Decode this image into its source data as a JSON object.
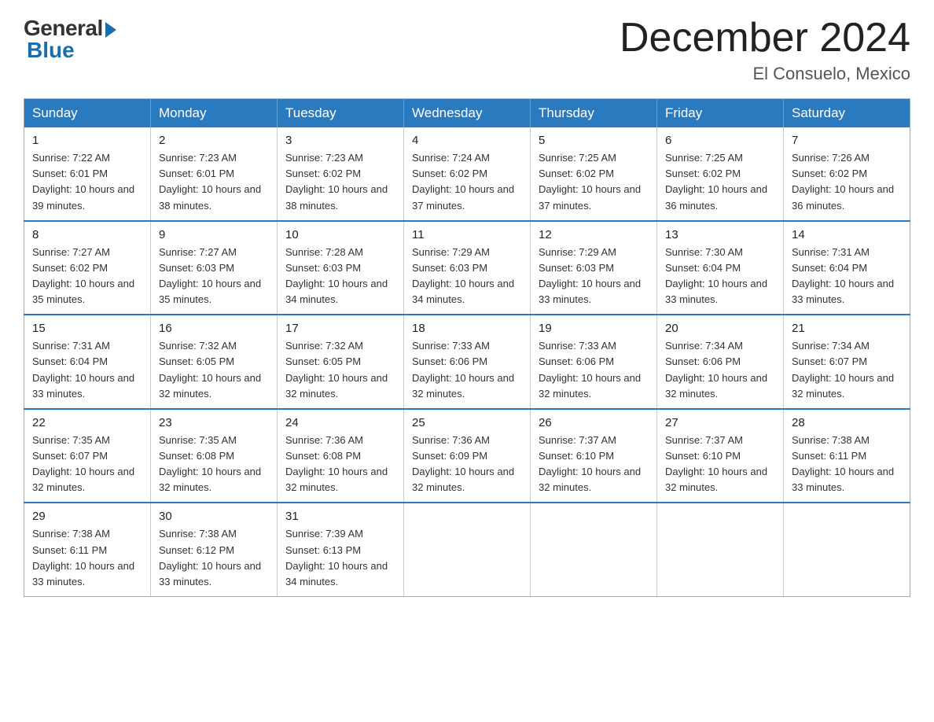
{
  "logo": {
    "general": "General",
    "blue": "Blue"
  },
  "title": "December 2024",
  "location": "El Consuelo, Mexico",
  "days_of_week": [
    "Sunday",
    "Monday",
    "Tuesday",
    "Wednesday",
    "Thursday",
    "Friday",
    "Saturday"
  ],
  "weeks": [
    [
      {
        "day": "1",
        "sunrise": "7:22 AM",
        "sunset": "6:01 PM",
        "daylight": "10 hours and 39 minutes."
      },
      {
        "day": "2",
        "sunrise": "7:23 AM",
        "sunset": "6:01 PM",
        "daylight": "10 hours and 38 minutes."
      },
      {
        "day": "3",
        "sunrise": "7:23 AM",
        "sunset": "6:02 PM",
        "daylight": "10 hours and 38 minutes."
      },
      {
        "day": "4",
        "sunrise": "7:24 AM",
        "sunset": "6:02 PM",
        "daylight": "10 hours and 37 minutes."
      },
      {
        "day": "5",
        "sunrise": "7:25 AM",
        "sunset": "6:02 PM",
        "daylight": "10 hours and 37 minutes."
      },
      {
        "day": "6",
        "sunrise": "7:25 AM",
        "sunset": "6:02 PM",
        "daylight": "10 hours and 36 minutes."
      },
      {
        "day": "7",
        "sunrise": "7:26 AM",
        "sunset": "6:02 PM",
        "daylight": "10 hours and 36 minutes."
      }
    ],
    [
      {
        "day": "8",
        "sunrise": "7:27 AM",
        "sunset": "6:02 PM",
        "daylight": "10 hours and 35 minutes."
      },
      {
        "day": "9",
        "sunrise": "7:27 AM",
        "sunset": "6:03 PM",
        "daylight": "10 hours and 35 minutes."
      },
      {
        "day": "10",
        "sunrise": "7:28 AM",
        "sunset": "6:03 PM",
        "daylight": "10 hours and 34 minutes."
      },
      {
        "day": "11",
        "sunrise": "7:29 AM",
        "sunset": "6:03 PM",
        "daylight": "10 hours and 34 minutes."
      },
      {
        "day": "12",
        "sunrise": "7:29 AM",
        "sunset": "6:03 PM",
        "daylight": "10 hours and 33 minutes."
      },
      {
        "day": "13",
        "sunrise": "7:30 AM",
        "sunset": "6:04 PM",
        "daylight": "10 hours and 33 minutes."
      },
      {
        "day": "14",
        "sunrise": "7:31 AM",
        "sunset": "6:04 PM",
        "daylight": "10 hours and 33 minutes."
      }
    ],
    [
      {
        "day": "15",
        "sunrise": "7:31 AM",
        "sunset": "6:04 PM",
        "daylight": "10 hours and 33 minutes."
      },
      {
        "day": "16",
        "sunrise": "7:32 AM",
        "sunset": "6:05 PM",
        "daylight": "10 hours and 32 minutes."
      },
      {
        "day": "17",
        "sunrise": "7:32 AM",
        "sunset": "6:05 PM",
        "daylight": "10 hours and 32 minutes."
      },
      {
        "day": "18",
        "sunrise": "7:33 AM",
        "sunset": "6:06 PM",
        "daylight": "10 hours and 32 minutes."
      },
      {
        "day": "19",
        "sunrise": "7:33 AM",
        "sunset": "6:06 PM",
        "daylight": "10 hours and 32 minutes."
      },
      {
        "day": "20",
        "sunrise": "7:34 AM",
        "sunset": "6:06 PM",
        "daylight": "10 hours and 32 minutes."
      },
      {
        "day": "21",
        "sunrise": "7:34 AM",
        "sunset": "6:07 PM",
        "daylight": "10 hours and 32 minutes."
      }
    ],
    [
      {
        "day": "22",
        "sunrise": "7:35 AM",
        "sunset": "6:07 PM",
        "daylight": "10 hours and 32 minutes."
      },
      {
        "day": "23",
        "sunrise": "7:35 AM",
        "sunset": "6:08 PM",
        "daylight": "10 hours and 32 minutes."
      },
      {
        "day": "24",
        "sunrise": "7:36 AM",
        "sunset": "6:08 PM",
        "daylight": "10 hours and 32 minutes."
      },
      {
        "day": "25",
        "sunrise": "7:36 AM",
        "sunset": "6:09 PM",
        "daylight": "10 hours and 32 minutes."
      },
      {
        "day": "26",
        "sunrise": "7:37 AM",
        "sunset": "6:10 PM",
        "daylight": "10 hours and 32 minutes."
      },
      {
        "day": "27",
        "sunrise": "7:37 AM",
        "sunset": "6:10 PM",
        "daylight": "10 hours and 32 minutes."
      },
      {
        "day": "28",
        "sunrise": "7:38 AM",
        "sunset": "6:11 PM",
        "daylight": "10 hours and 33 minutes."
      }
    ],
    [
      {
        "day": "29",
        "sunrise": "7:38 AM",
        "sunset": "6:11 PM",
        "daylight": "10 hours and 33 minutes."
      },
      {
        "day": "30",
        "sunrise": "7:38 AM",
        "sunset": "6:12 PM",
        "daylight": "10 hours and 33 minutes."
      },
      {
        "day": "31",
        "sunrise": "7:39 AM",
        "sunset": "6:13 PM",
        "daylight": "10 hours and 34 minutes."
      },
      null,
      null,
      null,
      null
    ]
  ]
}
